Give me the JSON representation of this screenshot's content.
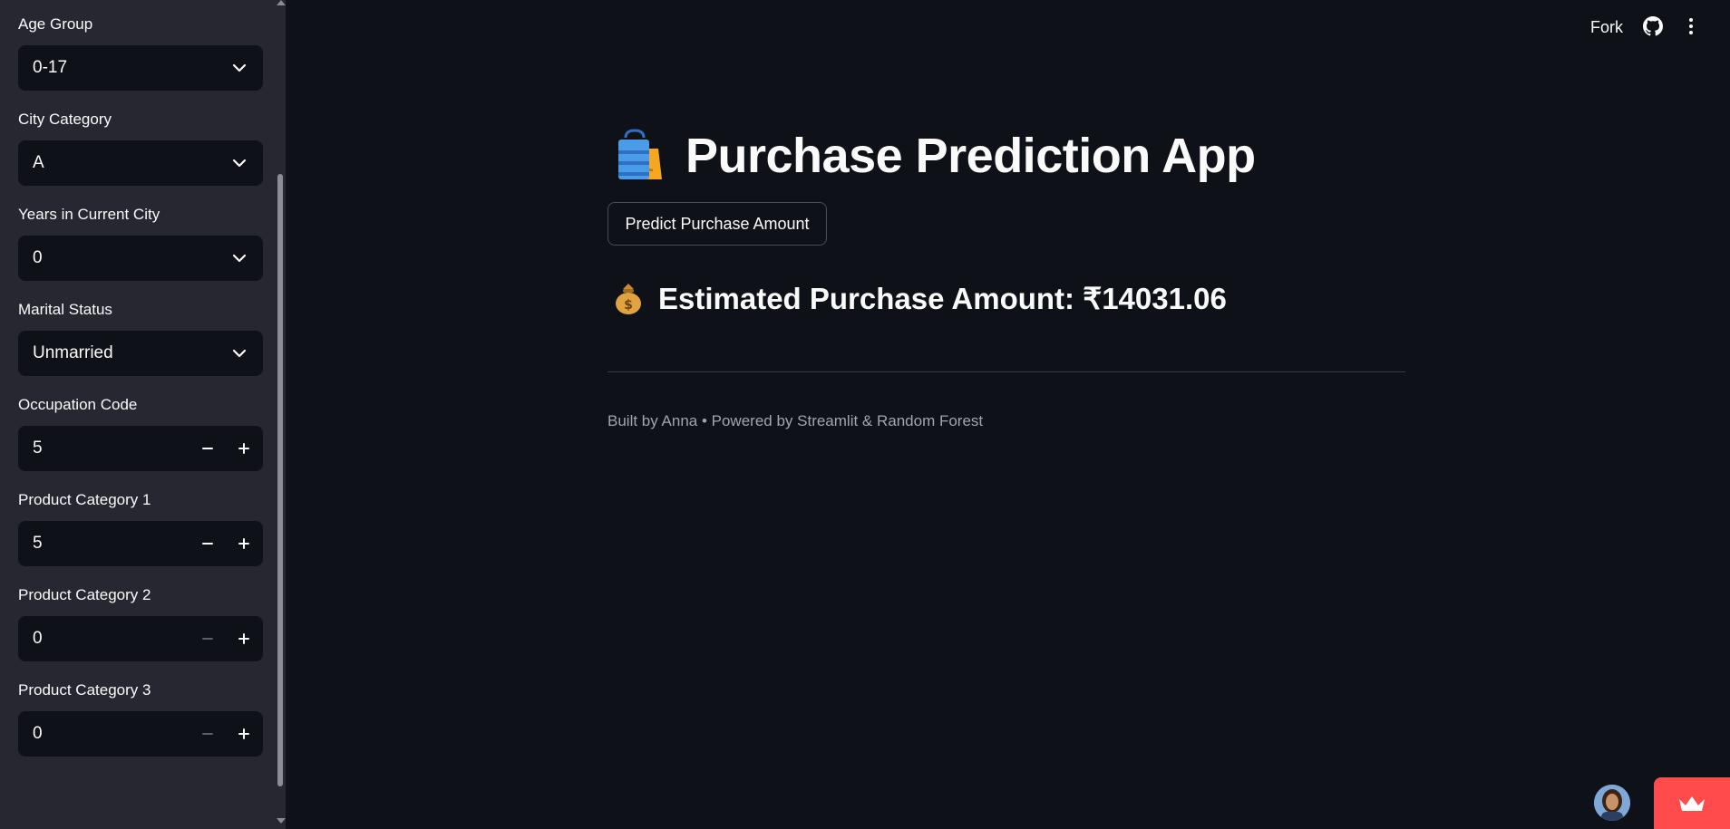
{
  "sidebar": {
    "age_group": {
      "label": "Age Group",
      "value": "0-17"
    },
    "city_category": {
      "label": "City Category",
      "value": "A"
    },
    "years_in_city": {
      "label": "Years in Current City",
      "value": "0"
    },
    "marital_status": {
      "label": "Marital Status",
      "value": "Unmarried"
    },
    "occupation": {
      "label": "Occupation Code",
      "value": "5"
    },
    "product_cat_1": {
      "label": "Product Category 1",
      "value": "5"
    },
    "product_cat_2": {
      "label": "Product Category 2",
      "value": "0"
    },
    "product_cat_3": {
      "label": "Product Category 3",
      "value": "0"
    }
  },
  "header": {
    "fork_label": "Fork"
  },
  "main": {
    "title": "Purchase Prediction App",
    "predict_button": "Predict Purchase Amount",
    "result": "Estimated Purchase Amount: ₹14031.06",
    "footer": "Built by Anna • Powered by Streamlit & Random Forest"
  },
  "colors": {
    "background": "#0e1117",
    "sidebar": "#262730",
    "accent": "#ff4b4b"
  },
  "icons": [
    "chevron-down-icon",
    "minus-icon",
    "plus-icon",
    "github-icon",
    "kebab-menu-icon",
    "shopping-bags-icon",
    "money-bag-icon",
    "crown-icon"
  ]
}
